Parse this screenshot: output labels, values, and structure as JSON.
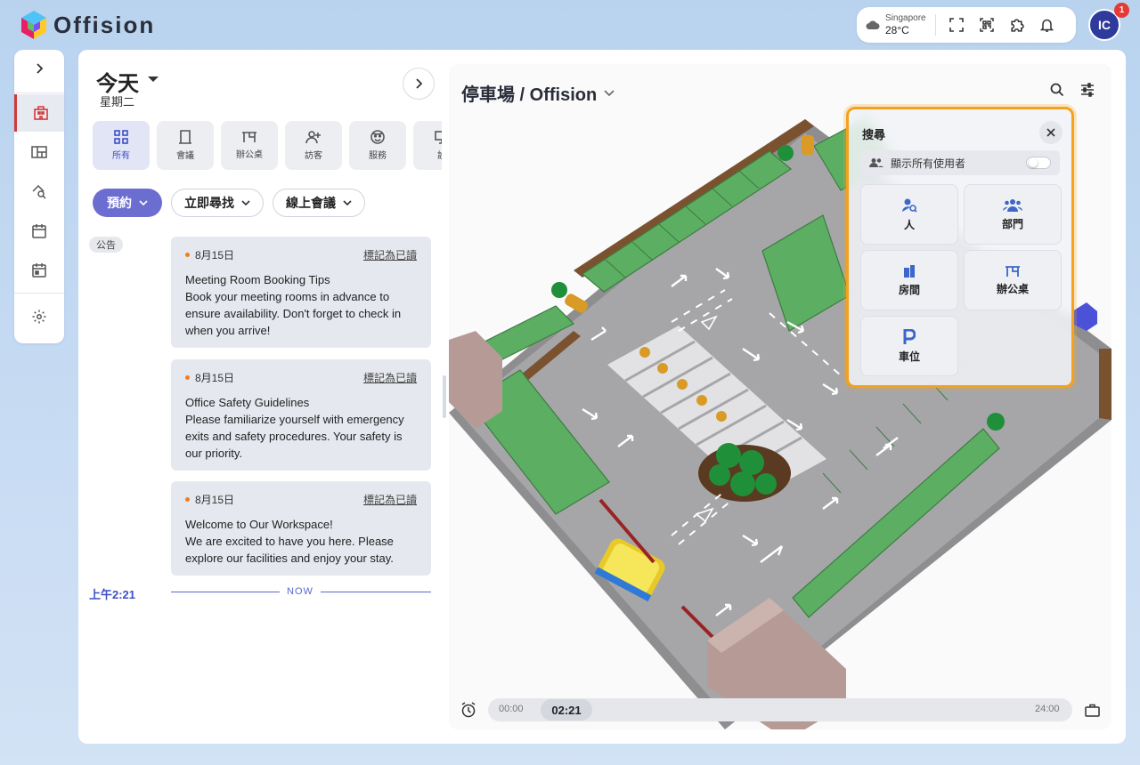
{
  "app": {
    "name": "Offision"
  },
  "topbar": {
    "weather_city": "Singapore",
    "weather_temp": "28°C",
    "avatar_initials": "IC",
    "notification_count": "1"
  },
  "sidebar": {
    "items": [
      {
        "icon": "chevron-right-icon"
      },
      {
        "icon": "building-icon",
        "active": true
      },
      {
        "icon": "floorplan-icon"
      },
      {
        "icon": "search-location-icon"
      },
      {
        "icon": "calendar-icon"
      },
      {
        "icon": "calendar-check-icon"
      },
      {
        "icon": "gear-icon"
      }
    ]
  },
  "today": {
    "title": "今天",
    "weekday": "星期二"
  },
  "categories": [
    {
      "label": "所有",
      "icon": "grid-icon",
      "active": true
    },
    {
      "label": "會議",
      "icon": "door-icon"
    },
    {
      "label": "辦公桌",
      "icon": "desk-icon"
    },
    {
      "label": "訪客",
      "icon": "person-add-icon"
    },
    {
      "label": "服務",
      "icon": "service-icon"
    },
    {
      "label": "設",
      "icon": "monitor-icon"
    }
  ],
  "actions": {
    "book": "預約",
    "find_now": "立即尋找",
    "online_meeting": "線上會議"
  },
  "announcements": {
    "chip": "公告",
    "items": [
      {
        "date": "8月15日",
        "mark": "標記為已讀",
        "title": "Meeting Room Booking Tips",
        "body": "Book your meeting rooms in advance to ensure availability. Don't forget to check in when you arrive!"
      },
      {
        "date": "8月15日",
        "mark": "標記為已讀",
        "title": "Office Safety Guidelines",
        "body": "Please familiarize yourself with emergency exits and safety procedures. Your safety is our priority."
      },
      {
        "date": "8月15日",
        "mark": "標記為已讀",
        "title": "Welcome to Our Workspace!",
        "body": "We are excited to have you here. Please explore our facilities and enjoy your stay."
      }
    ]
  },
  "timeline_now": {
    "time": "上午2:21",
    "label": "NOW"
  },
  "map": {
    "title": "停車場 / Offision"
  },
  "search_popup": {
    "title": "搜尋",
    "show_all_users": "顯示所有使用者",
    "show_all_users_on": false,
    "tiles": [
      {
        "label": "人",
        "icon": "person-search-icon"
      },
      {
        "label": "部門",
        "icon": "group-icon"
      },
      {
        "label": "房間",
        "icon": "door-icon"
      },
      {
        "label": "辦公桌",
        "icon": "desk-icon"
      },
      {
        "label": "車位",
        "icon": "parking-icon"
      }
    ]
  },
  "timeline": {
    "start": "00:00",
    "current": "02:21",
    "end": "24:00"
  },
  "colors": {
    "accent": "#6b6ed0",
    "active_blue": "#3c4fc6",
    "highlight": "#f3a21d",
    "danger": "#e53935"
  }
}
